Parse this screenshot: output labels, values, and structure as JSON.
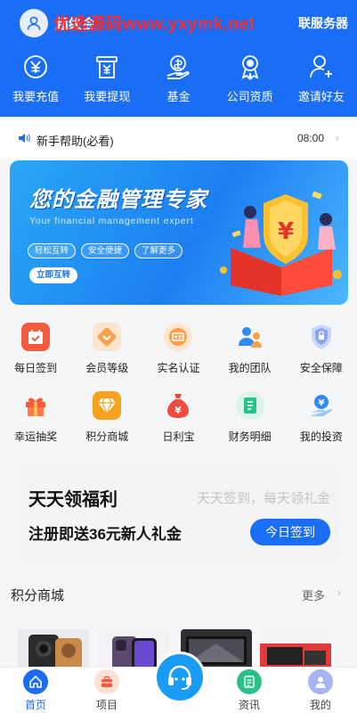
{
  "header": {
    "user_name": "超级会",
    "watermark": "优选源码www.yxymk.net",
    "service_label": "联服务器",
    "colors": {
      "primary": "#1a6df5",
      "watermark": "#ff2a2a"
    }
  },
  "quick_actions": [
    {
      "label": "我要充值",
      "icon": "yen-recharge-icon"
    },
    {
      "label": "我要提现",
      "icon": "yen-withdraw-icon"
    },
    {
      "label": "基金",
      "icon": "fund-icon"
    },
    {
      "label": "公司资质",
      "icon": "award-icon"
    },
    {
      "label": "邀请好友",
      "icon": "add-user-icon"
    }
  ],
  "notice": {
    "text": "新手帮助(必看)",
    "time": "08:00",
    "icon": "speaker-icon"
  },
  "banner": {
    "title": "您的金融管理专家",
    "subtitle": "Your financial management expert",
    "tags": [
      "轻松互转",
      "安全便捷",
      "了解更多"
    ],
    "cta": "立即互转"
  },
  "features": [
    {
      "label": "每日签到",
      "icon": "calendar-icon",
      "color": "#f45b3c"
    },
    {
      "label": "会员等级",
      "icon": "chevron-badge-icon",
      "color": "#f7a24b"
    },
    {
      "label": "实名认证",
      "icon": "id-card-icon",
      "color": "#f7a24b"
    },
    {
      "label": "我的团队",
      "icon": "team-icon",
      "color": "#2f8cf6"
    },
    {
      "label": "安全保障",
      "icon": "shield-icon",
      "color": "#8aa4f0"
    },
    {
      "label": "幸运抽奖",
      "icon": "gift-icon",
      "color": "#f45b3c"
    },
    {
      "label": "积分商城",
      "icon": "diamond-icon",
      "color": "#f6a21c"
    },
    {
      "label": "日利宝",
      "icon": "money-bag-icon",
      "color": "#f24a3d"
    },
    {
      "label": "财务明细",
      "icon": "ledger-icon",
      "color": "#2cc089"
    },
    {
      "label": "我的投资",
      "icon": "hand-yen-icon",
      "color": "#2f8cf6"
    }
  ],
  "welfare": {
    "title": "天天领福利",
    "subtitle": "天天签到，每天领礼金",
    "description": "注册即送36元新人礼金",
    "button": "今日签到"
  },
  "mall": {
    "title": "积分商城",
    "more": "更多",
    "products": [
      "phone-black",
      "phone-purple",
      "tv-dark",
      "console-red"
    ]
  },
  "tabbar": {
    "tabs": [
      {
        "label": "首页",
        "icon": "home-icon",
        "active": true
      },
      {
        "label": "项目",
        "icon": "briefcase-icon",
        "active": false
      },
      {
        "label": "",
        "icon": "customer-service-icon",
        "active": false
      },
      {
        "label": "资讯",
        "icon": "news-icon",
        "active": false
      },
      {
        "label": "我的",
        "icon": "user-icon",
        "active": false
      }
    ]
  }
}
